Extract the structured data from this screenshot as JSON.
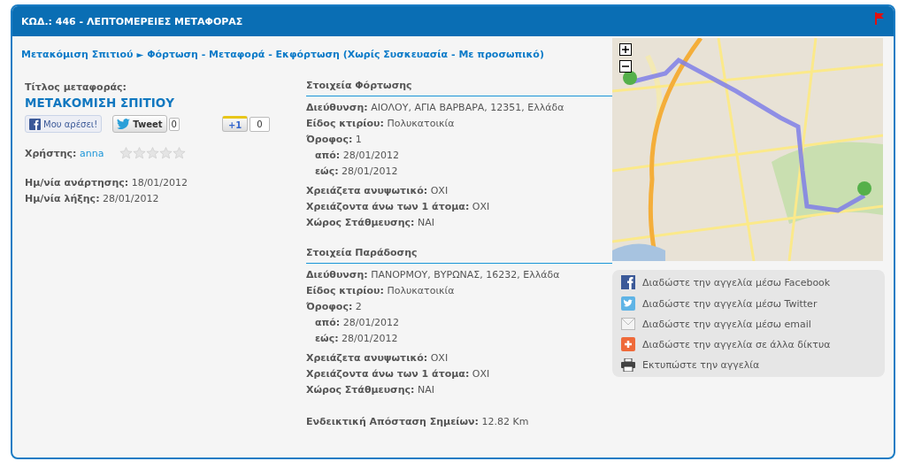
{
  "header": {
    "title": "ΚΩΔ.: 446 - ΛΕΠΤΟΜΕΡΕΙΕΣ ΜΕΤΑΦΟΡΑΣ"
  },
  "breadcrumb": {
    "parent": "Μετακόμιση Σπιτιού",
    "separator": "►",
    "current": "Φόρτωση - Μεταφορά - Εκφόρτωση (Χωρίς Συσκευασία - Με προσωπικό)"
  },
  "listing": {
    "title_label": "Τίτλος μεταφοράς:",
    "title": "ΜΕΤΑΚΟΜΙΣΗ ΣΠΙΤΙΟΥ",
    "social": [
      {
        "kind": "like",
        "label": "Μου αρέσει!"
      },
      {
        "kind": "tweet",
        "label": "Tweet",
        "count": "0"
      },
      {
        "kind": "plusone",
        "label": "+1",
        "count": "0"
      }
    ],
    "user_label": "Χρήστης:",
    "user": "anna",
    "stars": 0,
    "dates": [
      {
        "label": "Ημ/νία ανάρτησης:",
        "value": "18/01/2012"
      },
      {
        "label": "Ημ/νία λήξης:",
        "value": "28/01/2012"
      }
    ]
  },
  "sections": [
    {
      "title": "Στοιχεία Φόρτωσης",
      "groups": [
        {
          "rows": [
            {
              "kind": "field",
              "label": "Διεύθυνση:",
              "value": "ΑΙΟΛΟΥ, ΑΓΙΑ ΒΑΡΒΑΡΑ, 12351, Ελλάδα"
            },
            {
              "kind": "field",
              "label": "Είδος κτιρίου:",
              "value": "Πολυκατοικία"
            },
            {
              "kind": "field",
              "label": "Όροφος:",
              "value": "1"
            },
            {
              "kind": "sub",
              "label": "από:",
              "value": "28/01/2012"
            },
            {
              "kind": "sub",
              "label": "εώς:",
              "value": "28/01/2012"
            }
          ]
        },
        {
          "rows": [
            {
              "kind": "field",
              "label": "Χρειάζετα ανυψωτικό:",
              "value": "ΟΧΙ"
            },
            {
              "kind": "field",
              "label": "Χρειάζοντα άνω των 1 άτομα:",
              "value": "ΟΧΙ"
            },
            {
              "kind": "field",
              "label": "Χώρος Στάθμευσης:",
              "value": "ΝΑΙ"
            }
          ]
        }
      ]
    },
    {
      "title": "Στοιχεία Παράδοσης",
      "groups": [
        {
          "rows": [
            {
              "kind": "field",
              "label": "Διεύθυνση:",
              "value": "ΠΑΝΟΡΜΟΥ, ΒΥΡΩΝΑΣ, 16232, Ελλάδα"
            },
            {
              "kind": "field",
              "label": "Είδος κτιρίου:",
              "value": "Πολυκατοικία"
            },
            {
              "kind": "field",
              "label": "Όροφος:",
              "value": "2"
            },
            {
              "kind": "sub",
              "label": "από:",
              "value": "28/01/2012"
            },
            {
              "kind": "sub",
              "label": "εώς:",
              "value": "28/01/2012"
            }
          ]
        },
        {
          "rows": [
            {
              "kind": "field",
              "label": "Χρειάζετα ανυψωτικό:",
              "value": "ΟΧΙ"
            },
            {
              "kind": "field",
              "label": "Χρειάζοντα άνω των 1 άτομα:",
              "value": "ΟΧΙ"
            },
            {
              "kind": "field",
              "label": "Χώρος Στάθμευσης:",
              "value": "ΝΑΙ"
            }
          ]
        }
      ]
    }
  ],
  "distance": {
    "label": "Ενδεικτική Απόσταση Σημείων:",
    "value": "12.82 Km"
  },
  "share": [
    {
      "kind": "facebook",
      "label": "Διαδώστε την αγγελία μέσω Facebook"
    },
    {
      "kind": "twitter",
      "label": "Διαδώστε την αγγελία μέσω Twitter"
    },
    {
      "kind": "email",
      "label": "Διαδώστε την αγγελία μέσω email"
    },
    {
      "kind": "more",
      "label": "Διαδώστε την αγγελία σε άλλα δίκτυα"
    },
    {
      "kind": "print",
      "label": "Εκτυπώστε την αγγελία"
    }
  ]
}
